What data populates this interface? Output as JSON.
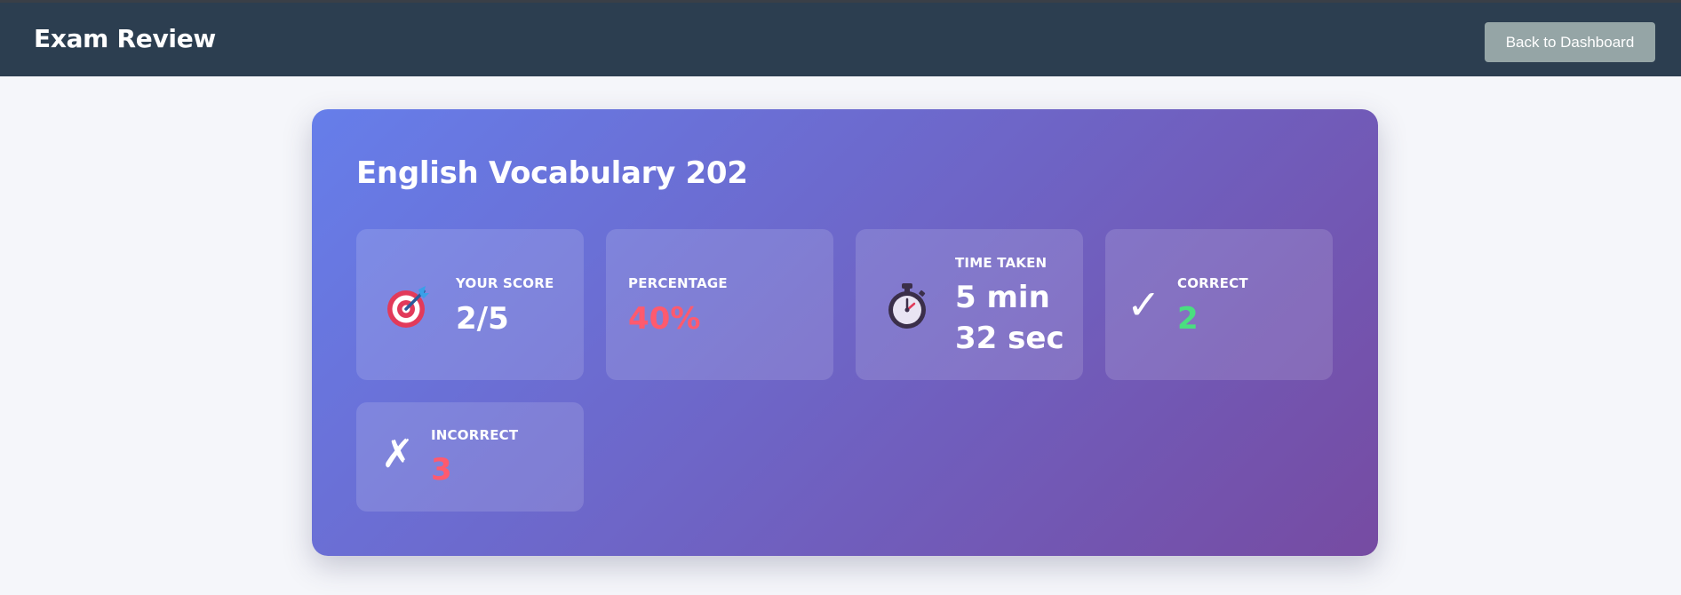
{
  "header": {
    "title": "Exam Review",
    "back_button_label": "Back to Dashboard"
  },
  "exam": {
    "title": "English Vocabulary 202"
  },
  "stats": {
    "score": {
      "label": "Your Score",
      "value": "2/5",
      "icon": "target-icon"
    },
    "percentage": {
      "label": "Percentage",
      "value": "40%"
    },
    "time": {
      "label": "Time Taken",
      "value_line1": "5 min",
      "value_line2": "32 sec",
      "icon": "stopwatch-icon"
    },
    "correct": {
      "label": "Correct",
      "value": "2",
      "icon": "check-icon"
    },
    "incorrect": {
      "label": "Incorrect",
      "value": "3",
      "icon": "x-icon"
    }
  },
  "colors": {
    "header_bg": "#2c3e50",
    "button_bg": "#95a5a6",
    "gradient_start": "#667eea",
    "gradient_end": "#764ba2",
    "negative": "#ff5a6e",
    "positive": "#4ade80"
  }
}
